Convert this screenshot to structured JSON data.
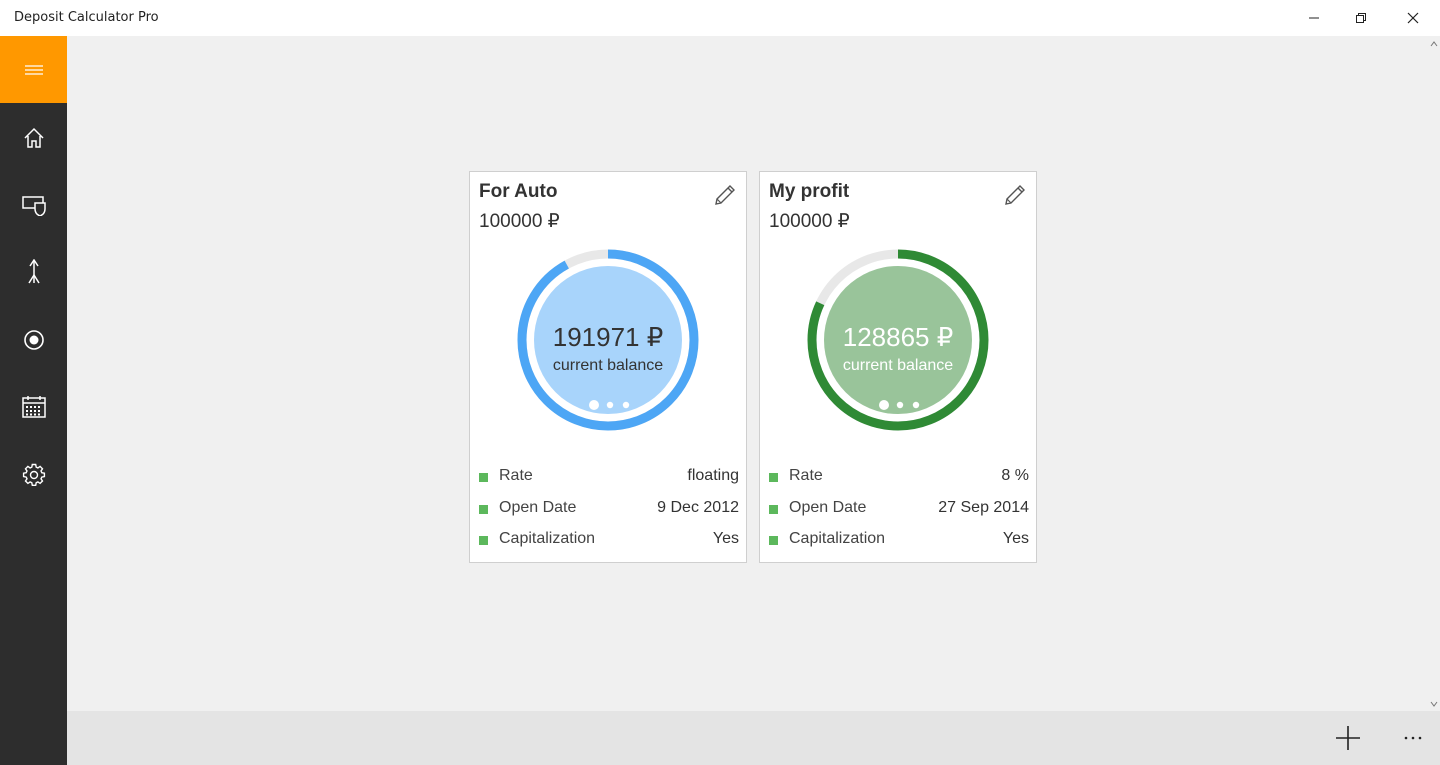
{
  "window": {
    "title": "Deposit Calculator Pro"
  },
  "sidebar": {
    "menu_icon": "hamburger-icon",
    "items": [
      {
        "icon": "home-icon"
      },
      {
        "icon": "shield-card-icon"
      },
      {
        "icon": "rocket-icon"
      },
      {
        "icon": "target-icon"
      },
      {
        "icon": "calendar-icon"
      },
      {
        "icon": "gear-icon"
      }
    ]
  },
  "cards": [
    {
      "title": "For Auto",
      "amount": "100000 ₽",
      "balance": "191971 ₽",
      "balance_label": "current balance",
      "progress": 0.92,
      "color_fill": "#a8d4fb",
      "color_ring": "#4da6f5",
      "text_color": "#333333",
      "rows": [
        {
          "label": "Rate",
          "value": "floating"
        },
        {
          "label": "Open Date",
          "value": "9 Dec 2012"
        },
        {
          "label": "Capitalization",
          "value": "Yes"
        }
      ]
    },
    {
      "title": "My profit",
      "amount": "100000 ₽",
      "balance": "128865 ₽",
      "balance_label": "current balance",
      "progress": 0.82,
      "color_fill": "#99c49a",
      "color_ring": "#2f8a35",
      "text_color": "#ffffff",
      "rows": [
        {
          "label": "Rate",
          "value": "8 %"
        },
        {
          "label": "Open Date",
          "value": "27 Sep 2014"
        },
        {
          "label": "Capitalization",
          "value": "Yes"
        }
      ]
    }
  ],
  "commandbar": {
    "add_icon": "plus-icon",
    "more_icon": "more-icon"
  },
  "colors": {
    "accent": "#ff9800",
    "sidebar": "#2d2d2d",
    "bullet": "#5cb85c"
  }
}
